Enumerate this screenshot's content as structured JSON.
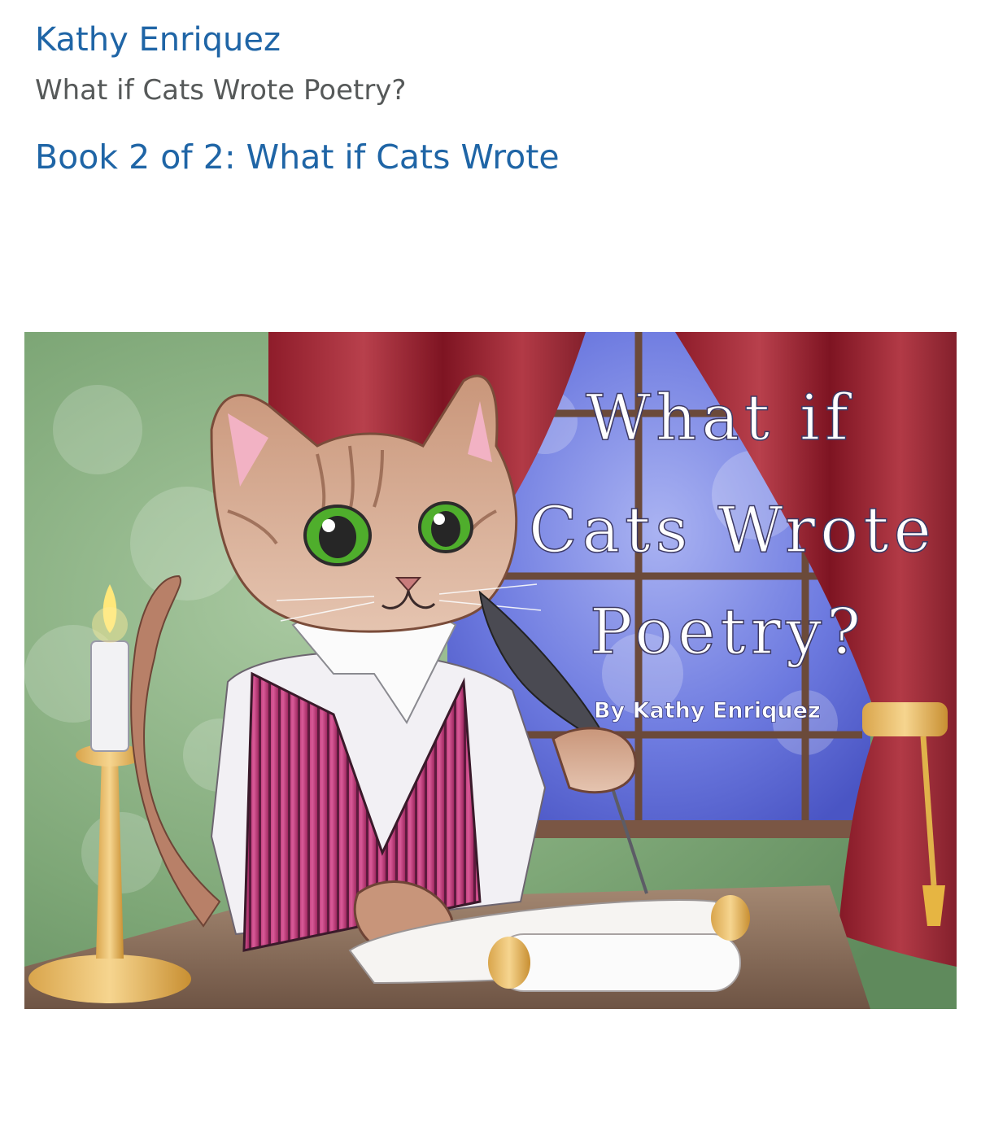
{
  "product": {
    "author": "Kathy Enriquez",
    "title": "What if Cats Wrote Poetry?",
    "series": "Book 2 of 2: What if Cats Wrote"
  },
  "cover": {
    "title_lines": [
      "What if",
      "Cats Wrote",
      "Poetry?"
    ],
    "byline": "By Kathy Enriquez"
  },
  "colors": {
    "link": "#1f65a6",
    "secondary_text": "#565959",
    "background": "#ffffff"
  }
}
